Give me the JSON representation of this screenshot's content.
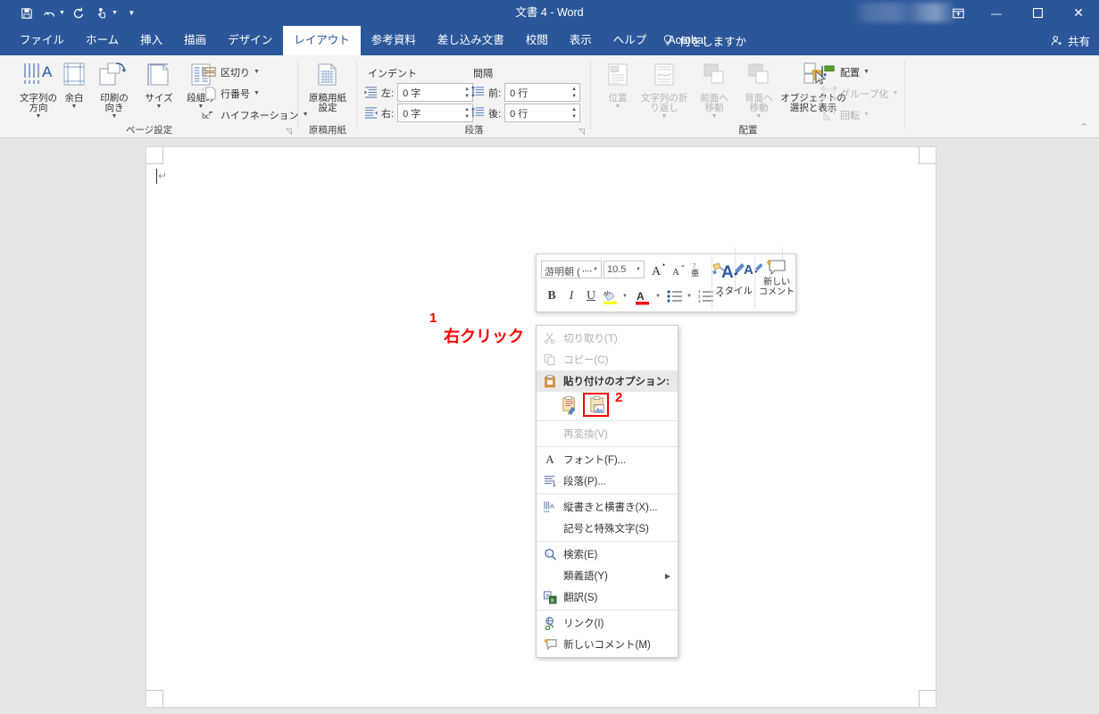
{
  "window": {
    "title": "文書 4  -  Word",
    "quick_access": [
      {
        "name": "save-icon",
        "glyph": "save"
      },
      {
        "name": "undo-icon",
        "glyph": "undo",
        "caret": true
      },
      {
        "name": "redo-icon",
        "glyph": "redo"
      },
      {
        "name": "touch-mode-icon",
        "glyph": "touch",
        "caret": true
      },
      {
        "name": "customize-qat-icon",
        "glyph": "caret"
      }
    ],
    "controls": {
      "ribbon_display": "⊞",
      "minimize": "—",
      "maximize": "☐",
      "close": "✕"
    },
    "share_label": "共有",
    "tellme_label": "何をしますか"
  },
  "tabs": [
    {
      "label": "ファイル",
      "active": false
    },
    {
      "label": "ホーム",
      "active": false
    },
    {
      "label": "挿入",
      "active": false
    },
    {
      "label": "描画",
      "active": false
    },
    {
      "label": "デザイン",
      "active": false
    },
    {
      "label": "レイアウト",
      "active": true
    },
    {
      "label": "参考資料",
      "active": false
    },
    {
      "label": "差し込み文書",
      "active": false
    },
    {
      "label": "校閲",
      "active": false
    },
    {
      "label": "表示",
      "active": false
    },
    {
      "label": "ヘルプ",
      "active": false
    },
    {
      "label": "Acrobat",
      "active": false
    }
  ],
  "ribbon": {
    "groups": [
      {
        "name": "page-setup",
        "label": "ページ設定"
      },
      {
        "name": "manuscript-paper",
        "label": "原稿用紙"
      },
      {
        "name": "paragraph",
        "label": "段落"
      },
      {
        "name": "arrange",
        "label": "配置"
      }
    ],
    "page_setup": {
      "text_direction": {
        "line1": "文字列の",
        "line2": "方向"
      },
      "margins": {
        "line1": "余白",
        "line2": ""
      },
      "orientation": {
        "line1": "印刷の",
        "line2": "向き"
      },
      "size": {
        "line1": "サイズ",
        "line2": ""
      },
      "columns": {
        "line1": "段組み",
        "line2": ""
      },
      "breaks": "区切り",
      "line_numbers": "行番号",
      "hyphenation": "ハイフネーション"
    },
    "manuscript": {
      "line1": "原稿用紙",
      "line2": "設定"
    },
    "paragraph": {
      "indent_header": "インデント",
      "spacing_header": "間隔",
      "indent_left_label": "左:",
      "indent_left_value": "0 字",
      "indent_right_label": "右:",
      "indent_right_value": "0 字",
      "spacing_before_label": "前:",
      "spacing_before_value": "0 行",
      "spacing_after_label": "後:",
      "spacing_after_value": "0 行"
    },
    "arrange": {
      "position": {
        "line1": "位置",
        "line2": ""
      },
      "wrap_text": {
        "line1": "文字列の折",
        "line2": "り返し"
      },
      "bring_forward": {
        "line1": "前面へ",
        "line2": "移動"
      },
      "send_backward": {
        "line1": "背面へ",
        "line2": "移動"
      },
      "selection_pane": {
        "line1": "オブジェクトの",
        "line2": "選択と表示"
      },
      "align": "配置",
      "group": "グループ化",
      "rotate": "回転"
    },
    "collapse_icon": "⌃"
  },
  "mini_toolbar": {
    "font_name": "游明朝 (᠁",
    "font_size": "10.5",
    "grow_font": "A",
    "shrink_font": "A",
    "phonetic_guide": "亜",
    "clear_formatting": "clear-format-icon",
    "text_effects": "A",
    "bold": "B",
    "italic": "I",
    "underline": "U",
    "highlight": "ab",
    "font_color": "A",
    "bullets": "bullets-icon",
    "numbering": "numbering-icon",
    "styles_label": "スタイル",
    "new_comment_line1": "新しい",
    "new_comment_line2": "コメント"
  },
  "context_menu": {
    "items": [
      {
        "name": "cut",
        "label": "切り取り(T)",
        "icon": "scissors-icon",
        "disabled": true,
        "type": "item"
      },
      {
        "name": "copy",
        "label": "コピー(C)",
        "icon": "copy-icon",
        "disabled": true,
        "type": "item"
      },
      {
        "name": "paste-options-header",
        "label": "貼り付けのオプション:",
        "icon": "clipboard-icon",
        "disabled": false,
        "type": "header"
      },
      {
        "name": "paste-options-row",
        "type": "paste-row",
        "options": [
          {
            "name": "paste-keep-source-formatting",
            "selected": false
          },
          {
            "name": "paste-picture",
            "selected": true
          }
        ]
      },
      {
        "name": "reconvert",
        "label": "再変換(V)",
        "icon": "",
        "disabled": true,
        "type": "item"
      },
      {
        "name": "font",
        "label": "フォント(F)...",
        "icon": "A",
        "disabled": false,
        "type": "item"
      },
      {
        "name": "paragraph",
        "label": "段落(P)...",
        "icon": "paragraph-icon",
        "disabled": false,
        "type": "item"
      },
      {
        "name": "text-direction",
        "label": "縦書きと横書き(X)...",
        "icon": "text-direction-icon",
        "disabled": false,
        "type": "item"
      },
      {
        "name": "symbols",
        "label": "記号と特殊文字(S)",
        "icon": "",
        "disabled": false,
        "type": "item"
      },
      {
        "name": "search",
        "label": "検索(E)",
        "icon": "magnifier-icon",
        "disabled": false,
        "type": "item"
      },
      {
        "name": "synonyms",
        "label": "類義語(Y)",
        "icon": "",
        "disabled": false,
        "type": "item",
        "submenu": "▶"
      },
      {
        "name": "translate",
        "label": "翻訳(S)",
        "icon": "translate-icon",
        "disabled": false,
        "type": "item"
      },
      {
        "name": "link",
        "label": "リンク(I)",
        "icon": "link-icon",
        "disabled": false,
        "type": "item"
      },
      {
        "name": "new-comment",
        "label": "新しいコメント(M)",
        "icon": "comment-icon",
        "disabled": false,
        "type": "item"
      }
    ]
  },
  "annotations": [
    {
      "name": "annotation-1",
      "number": "1",
      "text": "右クリック"
    },
    {
      "name": "annotation-2",
      "number": "2",
      "text": ""
    }
  ],
  "colors": {
    "titlebar": "#2b579a",
    "ribbon_bg": "#f3f3f3",
    "canvas_bg": "#e6e6e6",
    "page_bg": "#ffffff",
    "annotation_red": "#ff0000",
    "accent_blue": "#2b579a"
  }
}
